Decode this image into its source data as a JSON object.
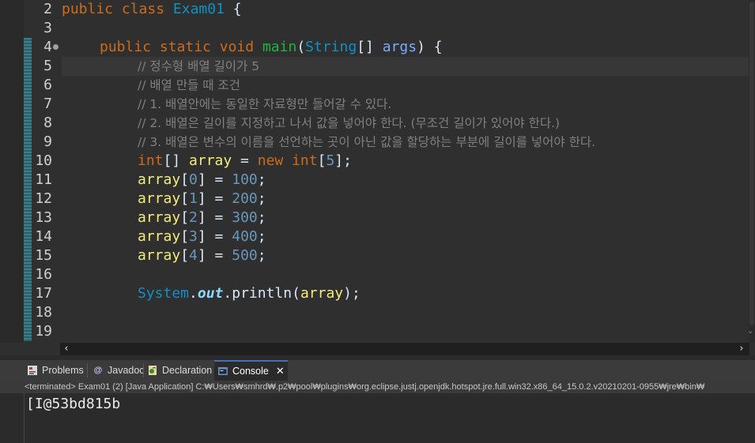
{
  "editor": {
    "file": "Exam01",
    "line_numbers": [
      "2",
      "3",
      "4",
      "5",
      "6",
      "7",
      "8",
      "9",
      "10",
      "11",
      "12",
      "13",
      "14",
      "15",
      "16",
      "17",
      "18",
      "19"
    ],
    "code": {
      "l2": [
        "public",
        " ",
        "class",
        " ",
        "Exam01",
        " {"
      ],
      "l4": [
        "public",
        " ",
        "static",
        " ",
        "void",
        " ",
        "main",
        "(",
        "String",
        "[] ",
        "args",
        ") {"
      ],
      "l5": "// 정수형 배열 길이가 5",
      "l6": "// 배열 만들 때 조건",
      "l7": "// 1. 배열안에는 동일한 자료형만 들어갈 수 있다.",
      "l8": "// 2. 배열은 길이를 지정하고 나서 값을 넣어야 한다. (무조건 길이가 있어야 한다.)",
      "l9": "// 3. 배열은 변수의 이름을 선언하는 곳이 아닌 값을 할당하는 부분에 길이를 넣어야 한다.",
      "l10": [
        "int",
        "[] ",
        "array",
        " = ",
        "new",
        " ",
        "int",
        "[",
        "5",
        "];"
      ],
      "assign": [
        {
          "var": "array",
          "idx": "0",
          "val": "100"
        },
        {
          "var": "array",
          "idx": "1",
          "val": "200"
        },
        {
          "var": "array",
          "idx": "2",
          "val": "300"
        },
        {
          "var": "array",
          "idx": "3",
          "val": "400"
        },
        {
          "var": "array",
          "idx": "4",
          "val": "500"
        }
      ],
      "l17": [
        "System",
        ".",
        "out",
        ".",
        "println",
        "(",
        "array",
        ");"
      ]
    }
  },
  "panel": {
    "tabs": [
      {
        "label": "Problems",
        "icon": "problems-icon"
      },
      {
        "label": "Javadoc",
        "icon": "javadoc-icon"
      },
      {
        "label": "Declaration",
        "icon": "declaration-icon"
      },
      {
        "label": "Console",
        "icon": "console-icon",
        "active": true
      }
    ],
    "console_description": "<terminated> Exam01 (2) [Java Application] C:₩Users₩smhrd₩.p2₩pool₩plugins₩org.eclipse.justj.openjdk.hotspot.jre.full.win32.x86_64_15.0.2.v20210201-0955₩jre₩bin₩",
    "console_output": "[I@53bd815b"
  },
  "colors": {
    "keyword": "#cc6c1d",
    "class": "#1290c3",
    "method": "#1eb540",
    "variable": "#f3ec79",
    "number": "#6897bb",
    "comment": "#808080",
    "background": "#2f2f2f"
  }
}
